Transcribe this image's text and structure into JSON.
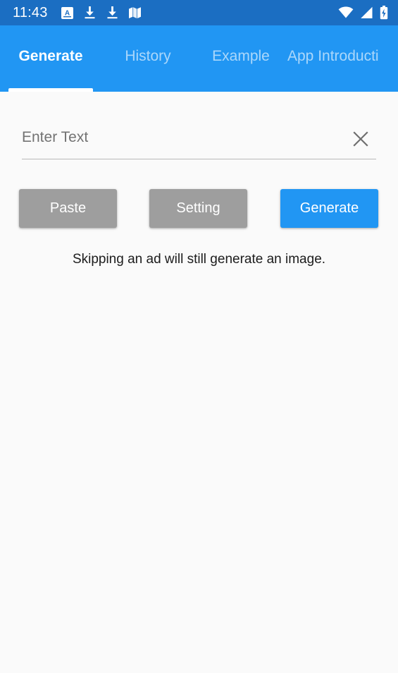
{
  "status_bar": {
    "clock": "11:43",
    "left_icons": [
      "letter-a-box-icon",
      "download-icon",
      "download-icon",
      "map-icon"
    ],
    "right_icons": [
      "wifi-icon",
      "cellular-signal-icon",
      "battery-charging-icon"
    ],
    "background_color": "#1b6ec2"
  },
  "tabs": {
    "items": [
      {
        "label": "Generate",
        "active": true
      },
      {
        "label": "History",
        "active": false
      },
      {
        "label": "Example",
        "active": false
      },
      {
        "label": "App Introducti",
        "active": false
      }
    ],
    "background_color": "#2196f3",
    "indicator_color": "#ffffff"
  },
  "input": {
    "value": "",
    "placeholder": "Enter Text",
    "clear_icon": "close-icon"
  },
  "buttons": {
    "paste": {
      "label": "Paste",
      "color": "#9e9e9e"
    },
    "setting": {
      "label": "Setting",
      "color": "#9e9e9e"
    },
    "generate": {
      "label": "Generate",
      "color": "#2196f3"
    }
  },
  "hint": {
    "text": "Skipping an ad will still generate an image."
  }
}
